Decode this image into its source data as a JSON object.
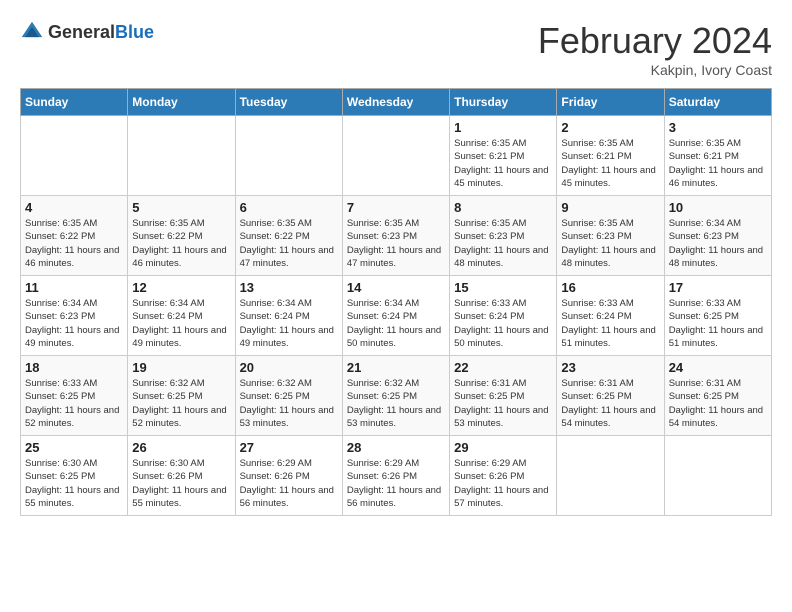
{
  "logo": {
    "general": "General",
    "blue": "Blue"
  },
  "header": {
    "title": "February 2024",
    "subtitle": "Kakpin, Ivory Coast"
  },
  "weekdays": [
    "Sunday",
    "Monday",
    "Tuesday",
    "Wednesday",
    "Thursday",
    "Friday",
    "Saturday"
  ],
  "weeks": [
    [
      {
        "day": "",
        "sunrise": "",
        "sunset": "",
        "daylight": ""
      },
      {
        "day": "",
        "sunrise": "",
        "sunset": "",
        "daylight": ""
      },
      {
        "day": "",
        "sunrise": "",
        "sunset": "",
        "daylight": ""
      },
      {
        "day": "",
        "sunrise": "",
        "sunset": "",
        "daylight": ""
      },
      {
        "day": "1",
        "sunrise": "Sunrise: 6:35 AM",
        "sunset": "Sunset: 6:21 PM",
        "daylight": "Daylight: 11 hours and 45 minutes."
      },
      {
        "day": "2",
        "sunrise": "Sunrise: 6:35 AM",
        "sunset": "Sunset: 6:21 PM",
        "daylight": "Daylight: 11 hours and 45 minutes."
      },
      {
        "day": "3",
        "sunrise": "Sunrise: 6:35 AM",
        "sunset": "Sunset: 6:21 PM",
        "daylight": "Daylight: 11 hours and 46 minutes."
      }
    ],
    [
      {
        "day": "4",
        "sunrise": "Sunrise: 6:35 AM",
        "sunset": "Sunset: 6:22 PM",
        "daylight": "Daylight: 11 hours and 46 minutes."
      },
      {
        "day": "5",
        "sunrise": "Sunrise: 6:35 AM",
        "sunset": "Sunset: 6:22 PM",
        "daylight": "Daylight: 11 hours and 46 minutes."
      },
      {
        "day": "6",
        "sunrise": "Sunrise: 6:35 AM",
        "sunset": "Sunset: 6:22 PM",
        "daylight": "Daylight: 11 hours and 47 minutes."
      },
      {
        "day": "7",
        "sunrise": "Sunrise: 6:35 AM",
        "sunset": "Sunset: 6:23 PM",
        "daylight": "Daylight: 11 hours and 47 minutes."
      },
      {
        "day": "8",
        "sunrise": "Sunrise: 6:35 AM",
        "sunset": "Sunset: 6:23 PM",
        "daylight": "Daylight: 11 hours and 48 minutes."
      },
      {
        "day": "9",
        "sunrise": "Sunrise: 6:35 AM",
        "sunset": "Sunset: 6:23 PM",
        "daylight": "Daylight: 11 hours and 48 minutes."
      },
      {
        "day": "10",
        "sunrise": "Sunrise: 6:34 AM",
        "sunset": "Sunset: 6:23 PM",
        "daylight": "Daylight: 11 hours and 48 minutes."
      }
    ],
    [
      {
        "day": "11",
        "sunrise": "Sunrise: 6:34 AM",
        "sunset": "Sunset: 6:23 PM",
        "daylight": "Daylight: 11 hours and 49 minutes."
      },
      {
        "day": "12",
        "sunrise": "Sunrise: 6:34 AM",
        "sunset": "Sunset: 6:24 PM",
        "daylight": "Daylight: 11 hours and 49 minutes."
      },
      {
        "day": "13",
        "sunrise": "Sunrise: 6:34 AM",
        "sunset": "Sunset: 6:24 PM",
        "daylight": "Daylight: 11 hours and 49 minutes."
      },
      {
        "day": "14",
        "sunrise": "Sunrise: 6:34 AM",
        "sunset": "Sunset: 6:24 PM",
        "daylight": "Daylight: 11 hours and 50 minutes."
      },
      {
        "day": "15",
        "sunrise": "Sunrise: 6:33 AM",
        "sunset": "Sunset: 6:24 PM",
        "daylight": "Daylight: 11 hours and 50 minutes."
      },
      {
        "day": "16",
        "sunrise": "Sunrise: 6:33 AM",
        "sunset": "Sunset: 6:24 PM",
        "daylight": "Daylight: 11 hours and 51 minutes."
      },
      {
        "day": "17",
        "sunrise": "Sunrise: 6:33 AM",
        "sunset": "Sunset: 6:25 PM",
        "daylight": "Daylight: 11 hours and 51 minutes."
      }
    ],
    [
      {
        "day": "18",
        "sunrise": "Sunrise: 6:33 AM",
        "sunset": "Sunset: 6:25 PM",
        "daylight": "Daylight: 11 hours and 52 minutes."
      },
      {
        "day": "19",
        "sunrise": "Sunrise: 6:32 AM",
        "sunset": "Sunset: 6:25 PM",
        "daylight": "Daylight: 11 hours and 52 minutes."
      },
      {
        "day": "20",
        "sunrise": "Sunrise: 6:32 AM",
        "sunset": "Sunset: 6:25 PM",
        "daylight": "Daylight: 11 hours and 53 minutes."
      },
      {
        "day": "21",
        "sunrise": "Sunrise: 6:32 AM",
        "sunset": "Sunset: 6:25 PM",
        "daylight": "Daylight: 11 hours and 53 minutes."
      },
      {
        "day": "22",
        "sunrise": "Sunrise: 6:31 AM",
        "sunset": "Sunset: 6:25 PM",
        "daylight": "Daylight: 11 hours and 53 minutes."
      },
      {
        "day": "23",
        "sunrise": "Sunrise: 6:31 AM",
        "sunset": "Sunset: 6:25 PM",
        "daylight": "Daylight: 11 hours and 54 minutes."
      },
      {
        "day": "24",
        "sunrise": "Sunrise: 6:31 AM",
        "sunset": "Sunset: 6:25 PM",
        "daylight": "Daylight: 11 hours and 54 minutes."
      }
    ],
    [
      {
        "day": "25",
        "sunrise": "Sunrise: 6:30 AM",
        "sunset": "Sunset: 6:25 PM",
        "daylight": "Daylight: 11 hours and 55 minutes."
      },
      {
        "day": "26",
        "sunrise": "Sunrise: 6:30 AM",
        "sunset": "Sunset: 6:26 PM",
        "daylight": "Daylight: 11 hours and 55 minutes."
      },
      {
        "day": "27",
        "sunrise": "Sunrise: 6:29 AM",
        "sunset": "Sunset: 6:26 PM",
        "daylight": "Daylight: 11 hours and 56 minutes."
      },
      {
        "day": "28",
        "sunrise": "Sunrise: 6:29 AM",
        "sunset": "Sunset: 6:26 PM",
        "daylight": "Daylight: 11 hours and 56 minutes."
      },
      {
        "day": "29",
        "sunrise": "Sunrise: 6:29 AM",
        "sunset": "Sunset: 6:26 PM",
        "daylight": "Daylight: 11 hours and 57 minutes."
      },
      {
        "day": "",
        "sunrise": "",
        "sunset": "",
        "daylight": ""
      },
      {
        "day": "",
        "sunrise": "",
        "sunset": "",
        "daylight": ""
      }
    ]
  ]
}
